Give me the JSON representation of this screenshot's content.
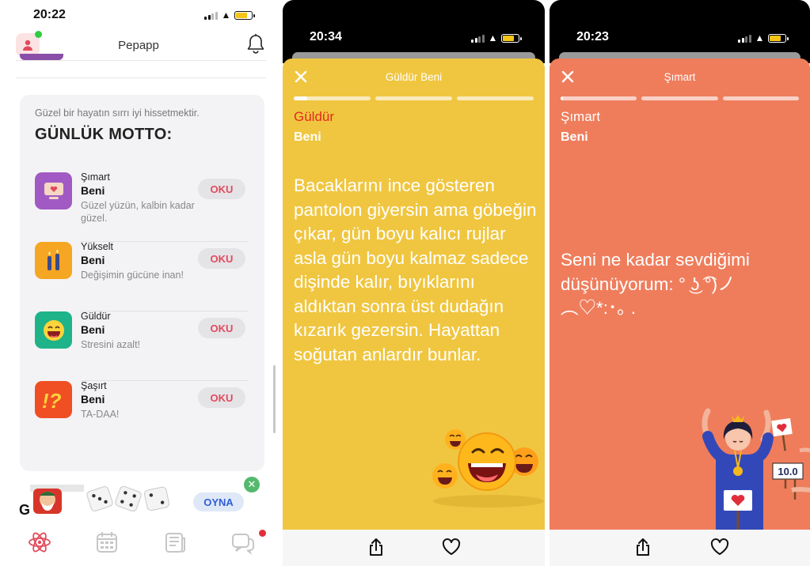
{
  "colors": {
    "story_yellow": "#f0c640",
    "story_coral": "#ef7d5c",
    "accent_red": "#e24a5c",
    "oyna_blue": "#2e5ed6",
    "notification_dot": "#e02f3a",
    "online_dot": "#2ecc40"
  },
  "panel1": {
    "status_time": "20:22",
    "header": {
      "title": "Pepapp",
      "avatar_icon": "user-icon",
      "bell_icon": "bell-icon"
    },
    "motto": {
      "subtitle": "Güzel bir hayatın sırrı iyi hissetmektir.",
      "title": "GÜNLÜK MOTTO:",
      "items": [
        {
          "category": "Şımart",
          "name": "Beni",
          "desc": "Güzel yüzün, kalbin kadar güzel.",
          "button": "OKU",
          "icon": "heart-monitor-icon",
          "icon_color": "#a15ac4"
        },
        {
          "category": "Yükselt",
          "name": "Beni",
          "desc": "Değişimin gücüne inan!",
          "button": "OKU",
          "icon": "candles-icon",
          "icon_color": "#f5a623"
        },
        {
          "category": "Güldür",
          "name": "Beni",
          "desc": "Stresini azalt!",
          "button": "OKU",
          "icon": "laughing-face-icon",
          "icon_color": "#1fb38a"
        },
        {
          "category": "Şaşırt",
          "name": "Beni",
          "desc": "TA-DAA!",
          "button": "OKU",
          "icon": "exclamation-question-icon",
          "icon_color": "#f04e23"
        }
      ]
    },
    "ad": {
      "partial_text": "G",
      "button": "OYNA"
    },
    "tabs": [
      "atom-icon",
      "calendar-icon",
      "news-icon",
      "chat-icon"
    ]
  },
  "panel2": {
    "status_time": "20:34",
    "title": "Güldür Beni",
    "category": "Güldür",
    "name": "Beni",
    "progress": [
      0.18,
      0,
      0
    ],
    "text": "Bacaklarını ince gösteren pantolon giyersin ama göbeğin çıkar, gün boyu kalıcı rujlar asla gün boyu kalmaz sadece dişinde kalır, bıyıklarını aldıktan sonra üst dudağın kızarık gezersin. Hayattan soğutan anlardır bunlar."
  },
  "panel3": {
    "status_time": "20:23",
    "title": "Şımart",
    "category": "Şımart",
    "name": "Beni",
    "progress": [
      0.03,
      0,
      0
    ],
    "text": "Seni ne kadar sevdiğimi düşünüyorum: ° ͜ʖ ͡°)ノ ︵♡*:･｡ .",
    "score_sign": "10.0"
  }
}
